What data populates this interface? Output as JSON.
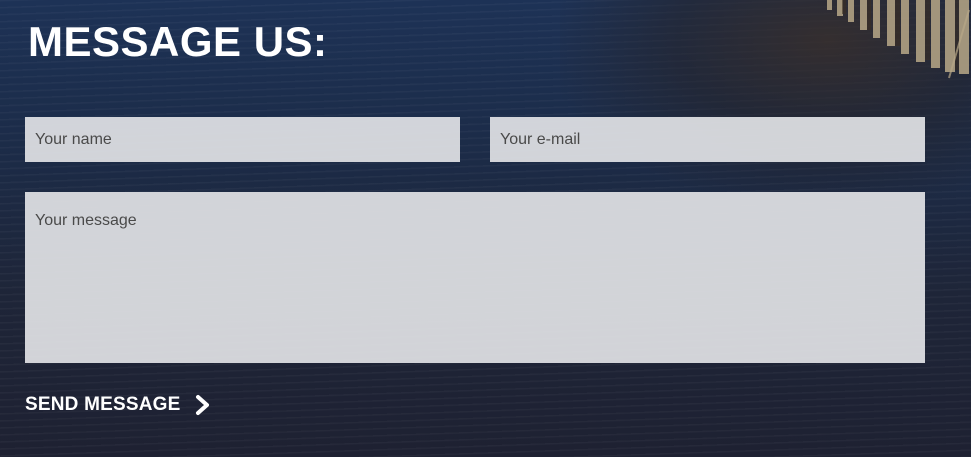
{
  "form": {
    "title": "MESSAGE US:",
    "name_placeholder": "Your name",
    "email_placeholder": "Your e-mail",
    "message_placeholder": "Your message",
    "send_label": "SEND MESSAGE"
  },
  "icons": {
    "send": "chevron-right-icon"
  },
  "colors": {
    "text": "#ffffff",
    "field_background": "#e2e3e6",
    "background": "#1e2538"
  }
}
